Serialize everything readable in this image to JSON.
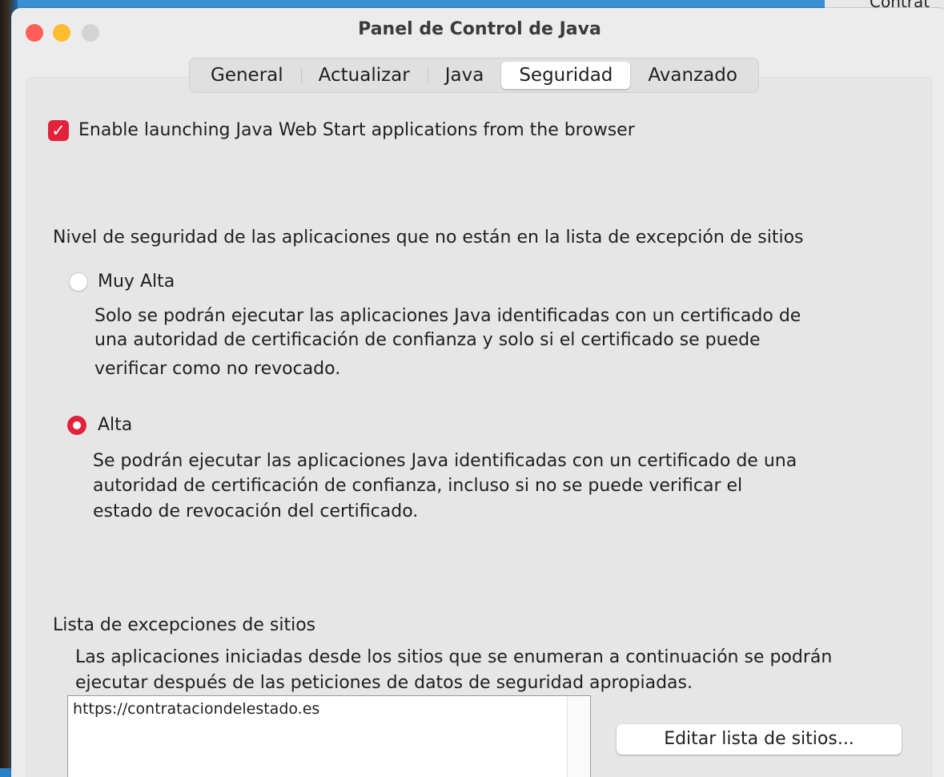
{
  "background": {
    "corner_text": "Contrat"
  },
  "window": {
    "title": "Panel de Control de Java"
  },
  "tabs": [
    {
      "label": "General",
      "active": false
    },
    {
      "label": "Actualizar",
      "active": false
    },
    {
      "label": "Java",
      "active": false
    },
    {
      "label": "Seguridad",
      "active": true
    },
    {
      "label": "Avanzado",
      "active": false
    }
  ],
  "web_start": {
    "checked": true,
    "label": "Enable launching Java Web Start applications from the browser"
  },
  "security_level": {
    "heading": "Nivel de seguridad de las aplicaciones que no están en la lista de excepción de sitios",
    "options": [
      {
        "label": "Muy Alta",
        "selected": false,
        "description": [
          "Solo se podrán ejecutar las aplicaciones Java identificadas con un certificado de",
          "una autoridad de certificación de confianza y solo si el certificado se puede",
          "verificar como no revocado."
        ]
      },
      {
        "label": "Alta",
        "selected": true,
        "description": [
          "Se podrán ejecutar las aplicaciones Java identificadas con un certificado de una",
          "autoridad de certificación de confianza, incluso si no se puede verificar el",
          "estado de revocación del certificado."
        ]
      }
    ]
  },
  "exceptions": {
    "heading": "Lista de excepciones de sitios",
    "description": [
      "Las aplicaciones iniciadas desde los sitios que se enumeran a continuación se podrán",
      "ejecutar después de las peticiones de datos de seguridad apropiadas."
    ],
    "sites": [
      "https://contrataciondelestado.es"
    ],
    "edit_button": "Editar lista de sitios..."
  },
  "colors": {
    "accent": "#e0223a",
    "window_bg": "#ececec",
    "desktop_bg": "#2b7fc4"
  }
}
